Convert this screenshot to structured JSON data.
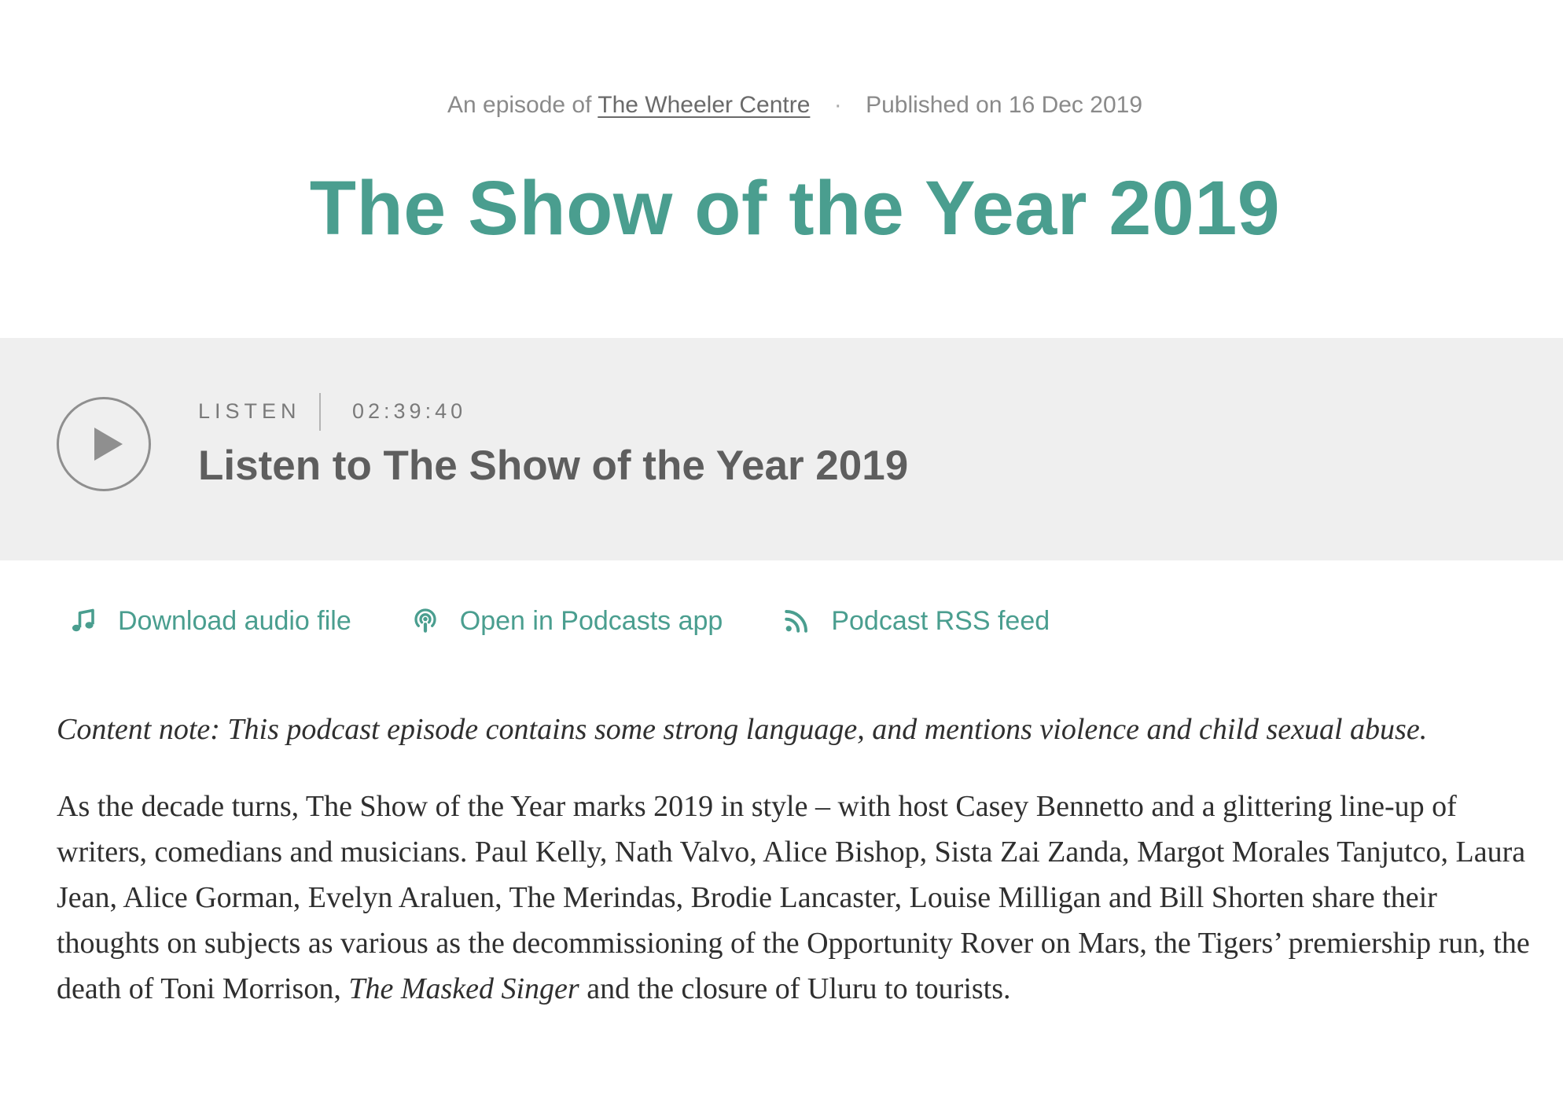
{
  "meta": {
    "prefix": "An episode of",
    "show_name": "The Wheeler Centre",
    "separator": "·",
    "published": "Published on 16 Dec 2019"
  },
  "title": "The Show of the Year 2019",
  "player": {
    "label": "LISTEN",
    "duration": "02:39:40",
    "title": "Listen to The Show of the Year 2019",
    "play_icon": "play-icon"
  },
  "links": [
    {
      "label": "Download audio file",
      "icon": "music-note-icon"
    },
    {
      "label": "Open in Podcasts app",
      "icon": "podcast-icon"
    },
    {
      "label": "Podcast RSS feed",
      "icon": "rss-icon"
    }
  ],
  "content_note": "Content note: This podcast episode contains some strong language, and mentions violence and child sexual abuse.",
  "description": {
    "part1": "As the decade turns, The Show of the Year marks 2019 in style – with host Casey Bennetto and a glittering line-up of writers, comedians and musicians. Paul Kelly, Nath Valvo, Alice Bishop, Sista Zai Zanda, Margot Morales Tanjutco, Laura Jean, Alice Gorman, Evelyn Araluen, The Merindas, Brodie Lancaster, Louise Milligan and Bill Shorten share their thoughts on subjects as various as the decommissioning of the Opportunity Rover on Mars, the Tigers’ premiership run, the death of Toni Morrison,",
    "italic": "The Masked Singer",
    "part2": "and the closure of Uluru to tourists."
  },
  "colors": {
    "accent": "#4a9e8f",
    "player_bg": "#efefef",
    "body_text": "#2f2f2f",
    "muted_text": "#8a8a8a"
  }
}
